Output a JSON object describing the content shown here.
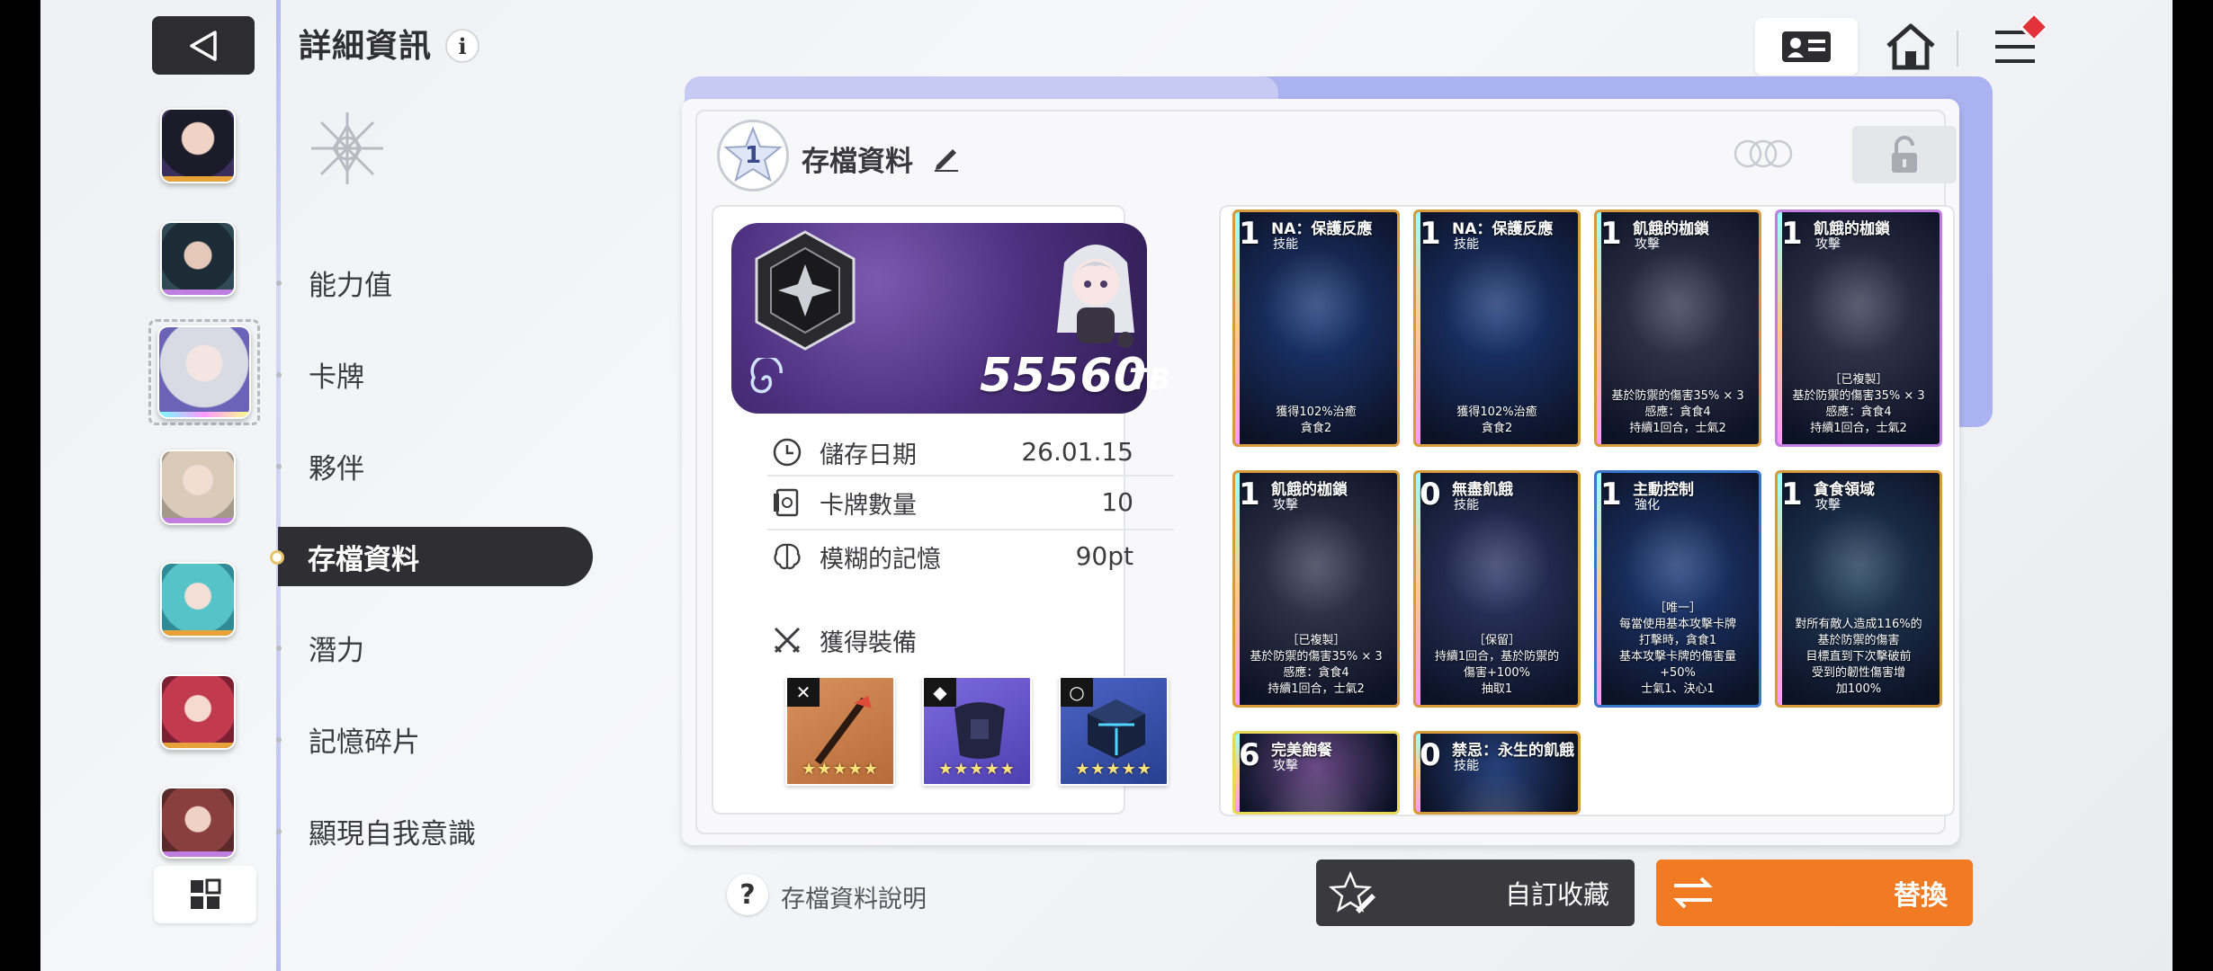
{
  "header": {
    "title": "詳細資訊",
    "info_icon": "i"
  },
  "nav": {
    "items": [
      {
        "label": "能力值"
      },
      {
        "label": "卡牌"
      },
      {
        "label": "夥伴"
      },
      {
        "label": "存檔資料"
      },
      {
        "label": "潛力"
      },
      {
        "label": "記憶碎片"
      },
      {
        "label": "顯現自我意識"
      }
    ],
    "active_index": 3
  },
  "save": {
    "badge_number": "1",
    "title": "存檔資料",
    "score": "55560",
    "score_unit": "TB",
    "rows": [
      {
        "icon": "clock-icon",
        "label": "儲存日期",
        "value": "26.01.15"
      },
      {
        "icon": "card-count-icon",
        "label": "卡牌數量",
        "value": "10"
      },
      {
        "icon": "brain-icon",
        "label": "模糊的記憶",
        "value": "90pt"
      }
    ],
    "equipment_title": "獲得裝備",
    "equipment": [
      {
        "slot": "weapon-icon",
        "stars": "★★★★★",
        "color": "#c8743c"
      },
      {
        "slot": "armor-icon",
        "stars": "★★★★★",
        "color": "#6a5ad0"
      },
      {
        "slot": "ring-icon",
        "stars": "★★★★★",
        "color": "#3550a8"
      }
    ]
  },
  "cards": [
    {
      "cost": "1",
      "name": "NA：保護反應",
      "type": "技能",
      "desc": "獲得102%治癒\n貪食2",
      "bg": "#1d3a78",
      "border": "#d79a3c"
    },
    {
      "cost": "1",
      "name": "NA：保護反應",
      "type": "技能",
      "desc": "獲得102%治癒\n貪食2",
      "bg": "#1d3a78",
      "border": "#d79a3c"
    },
    {
      "cost": "1",
      "name": "飢餓的枷鎖",
      "type": "攻擊",
      "desc": "基於防禦的傷害35% × 3\n感應：貪食4\n持續1回合，士氣2",
      "bg": "#3a3e55",
      "border": "#d79a3c"
    },
    {
      "cost": "1",
      "name": "飢餓的枷鎖",
      "type": "攻擊",
      "desc": "［已複製］\n基於防禦的傷害35% × 3\n感應：貪食4\n持續1回合，士氣2",
      "bg": "#3a3e55",
      "border": "#c07ee0"
    },
    {
      "cost": "1",
      "name": "飢餓的枷鎖",
      "type": "攻擊",
      "desc": "［已複製］\n基於防禦的傷害35% × 3\n感應：貪食4\n持續1回合，士氣2",
      "bg": "#3a3e55",
      "border": "#d79a3c"
    },
    {
      "cost": "0",
      "name": "無盡飢餓",
      "type": "技能",
      "desc": "［保留］\n持續1回合，基於防禦的\n傷害+100%\n抽取1",
      "bg": "#2e3a68",
      "border": "#d79a3c"
    },
    {
      "cost": "1",
      "name": "主動控制",
      "type": "強化",
      "desc": "［唯一］\n每當使用基本攻擊卡牌\n打擊時，貪食1\n基本攻擊卡牌的傷害量\n+50%\n士氣1、決心1",
      "bg": "#1f3d7a",
      "border": "#3a76c8"
    },
    {
      "cost": "1",
      "name": "貪食領域",
      "type": "攻擊",
      "desc": "對所有敵人造成116%的\n基於防禦的傷害\n目標直到下次擊破前\n受到的韌性傷害增\n加100%",
      "bg": "#24405e",
      "border": "#d79a3c"
    },
    {
      "cost": "6",
      "name": "完美飽餐",
      "type": "攻擊",
      "desc": "",
      "bg": "#6a4a86",
      "border": "#e8d85a"
    },
    {
      "cost": "0",
      "name": "禁忌：永生的飢餓",
      "type": "技能",
      "desc": "",
      "bg": "#25407a",
      "border": "#d79a3c"
    }
  ],
  "footer": {
    "help_label": "存檔資料說明",
    "collect_label": "自訂收藏",
    "replace_label": "替換"
  },
  "colors": {
    "accent_orange": "#f07b23",
    "dark_button": "#3a3a3e",
    "panel_accent": "#aab2ef"
  }
}
